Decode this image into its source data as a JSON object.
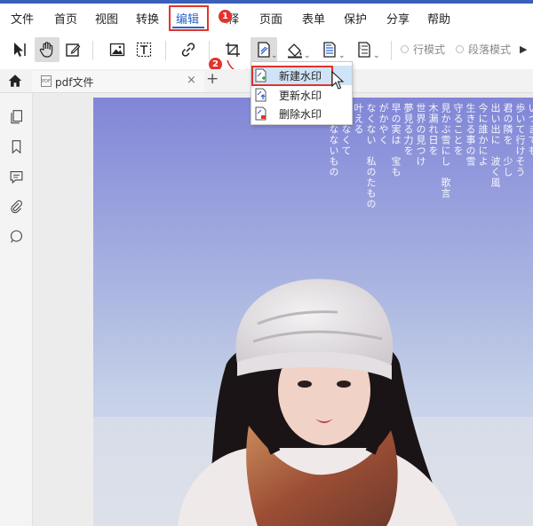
{
  "menu": {
    "items": [
      {
        "label": "文件"
      },
      {
        "label": "首页"
      },
      {
        "label": "视图"
      },
      {
        "label": "转换"
      },
      {
        "label": "编辑"
      },
      {
        "label": "注释"
      },
      {
        "label": "页面"
      },
      {
        "label": "表单"
      },
      {
        "label": "保护"
      },
      {
        "label": "分享"
      },
      {
        "label": "帮助"
      }
    ],
    "active_index": 4
  },
  "annotations": {
    "step1": "1",
    "step2": "2"
  },
  "toolbar": {
    "tools": [
      "select-tool",
      "hand-tool",
      "edit-text-tool",
      "add-image-tool",
      "add-text-tool",
      "link-tool",
      "crop-tool",
      "watermark-tool",
      "background-tool",
      "header-footer-tool",
      "bates-number-tool"
    ],
    "radio_line_mode": "行模式",
    "radio_paragraph_mode": "段落模式"
  },
  "tabs": {
    "items": [
      {
        "label": "pdf文件"
      }
    ],
    "close_glyph": "×",
    "add_glyph": "+"
  },
  "sidebar": {
    "icons": [
      "pages-icon",
      "bookmark-icon",
      "comment-icon",
      "attachment-icon",
      "search-icon"
    ]
  },
  "watermark_menu": {
    "items": [
      {
        "label": "新建水印"
      },
      {
        "label": "更新水印"
      },
      {
        "label": "删除水印"
      }
    ],
    "hovered_index": 0
  },
  "document_text": {
    "columns": [
      "いつまでも",
      "歩いて行けそう",
      "君の隣を　少し",
      "出い出に　波く風",
      "今に誰かによ",
      "生きる事の雪",
      "守ることを",
      "見かぶ雪にし　歌言",
      "木漏れ日を",
      "世界の見つけ",
      "夢見る力を",
      "早の実は　宝も",
      "がかやく",
      "なくない　私のたもの",
      "叶える",
      "がけなくて",
      "世界なないもの"
    ]
  },
  "colors": {
    "accent": "#2b63c9",
    "highlight": "#e0342c",
    "menu_hover": "#cfe4f7"
  }
}
